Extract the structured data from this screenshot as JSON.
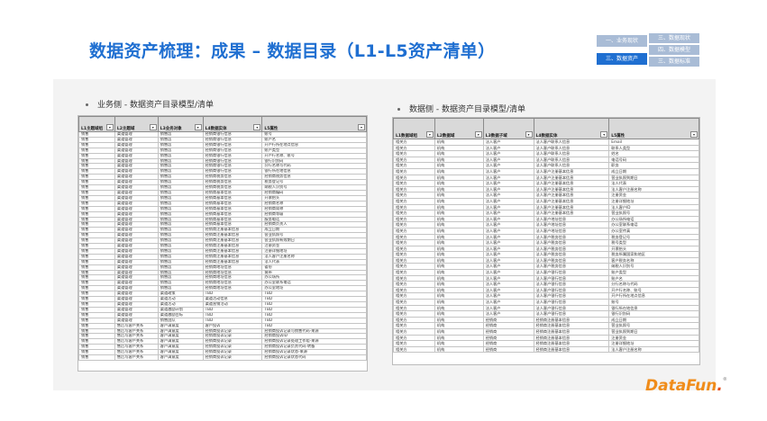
{
  "slide": {
    "title": "数据资产梳理：成果 – 数据目录（L1-L5资产清单）"
  },
  "nav": {
    "cells": [
      {
        "label": "一、业务现状",
        "bg": "#a9bcd6",
        "active": false
      },
      {
        "label": "三、数据资产",
        "bg": "#1f6fd1",
        "active": true
      },
      {
        "label": "三、数据现状",
        "bg": "#a9bcd6",
        "active": false
      },
      {
        "label": "四、数据模型",
        "bg": "#a9bcd6",
        "active": false
      },
      {
        "label": "三、数据标准",
        "bg": "#a9bcd6",
        "active": false
      }
    ]
  },
  "left": {
    "subtitle": "业务侧 - 数据资产目录模型/清单",
    "headers": [
      "L1主题域组",
      "L2主题域",
      "L3业务对象",
      "L4数据实体",
      "L5属性"
    ],
    "rows": [
      [
        "销售",
        "渠道管理",
        "销售店",
        "经销商银行信息",
        "账号"
      ],
      [
        "销售",
        "渠道管理",
        "销售店",
        "经销商银行信息",
        "账户名"
      ],
      [
        "销售",
        "渠道管理",
        "销售店",
        "经销商银行信息",
        "开户行所在地点信息"
      ],
      [
        "销售",
        "渠道管理",
        "销售店",
        "经销商银行信息",
        "账户类型"
      ],
      [
        "销售",
        "渠道管理",
        "销售店",
        "经销商银行信息",
        "开户行名称、账号"
      ],
      [
        "销售",
        "渠道管理",
        "销售店",
        "经销商银行信息",
        "银行识别码"
      ],
      [
        "销售",
        "渠道管理",
        "销售店",
        "经销商银行信息",
        "分行名称与代码"
      ],
      [
        "销售",
        "渠道管理",
        "销售店",
        "经销商银行信息",
        "银行所在地信息"
      ],
      [
        "销售",
        "渠道管理",
        "销售店",
        "经销商税务信息",
        "经销商税务信息"
      ],
      [
        "销售",
        "渠道管理",
        "销售店",
        "经销商税务信息",
        "税务登记号"
      ],
      [
        "销售",
        "渠道管理",
        "销售店",
        "经销商税务信息",
        "纳税人识别号"
      ],
      [
        "销售",
        "渠道管理",
        "销售店",
        "经销商基本信息",
        "经销商编码"
      ],
      [
        "销售",
        "渠道管理",
        "销售店",
        "经销商基本信息",
        "开票抬头"
      ],
      [
        "销售",
        "渠道管理",
        "销售店",
        "经销商基本信息",
        "经销商名称"
      ],
      [
        "销售",
        "渠道管理",
        "销售店",
        "经销商基本信息",
        "经销商简称"
      ],
      [
        "销售",
        "渠道管理",
        "销售店",
        "经销商基本信息",
        "经销商等级"
      ],
      [
        "销售",
        "渠道管理",
        "销售店",
        "经销商基本信息",
        "服务电话"
      ],
      [
        "销售",
        "渠道管理",
        "销售店",
        "经销商基本信息",
        "经销商负责人"
      ],
      [
        "销售",
        "渠道管理",
        "销售店",
        "经销商注册基本信息",
        "成立日期"
      ],
      [
        "销售",
        "渠道管理",
        "销售店",
        "经销商注册基本信息",
        "营业执照号"
      ],
      [
        "销售",
        "渠道管理",
        "销售店",
        "经销商注册基本信息",
        "营业执照有效期日"
      ],
      [
        "销售",
        "渠道管理",
        "销售店",
        "经销商注册基本信息",
        "注册资金"
      ],
      [
        "销售",
        "渠道管理",
        "销售店",
        "经销商注册基本信息",
        "注册详细地址"
      ],
      [
        "销售",
        "渠道管理",
        "销售店",
        "经销商注册基本信息",
        "法人客户注册名称"
      ],
      [
        "销售",
        "渠道管理",
        "销售店",
        "经销商注册基本信息",
        "法人代表"
      ],
      [
        "销售",
        "渠道管理",
        "销售店",
        "经销商地址信息",
        "省份"
      ],
      [
        "销售",
        "渠道管理",
        "销售店",
        "经销商地址信息",
        "城市"
      ],
      [
        "销售",
        "渠道管理",
        "销售店",
        "经销商地址信息",
        "办公场所"
      ],
      [
        "销售",
        "渠道管理",
        "销售店",
        "经销商地址信息",
        "办公室联系电话"
      ],
      [
        "销售",
        "渠道管理",
        "销售店",
        "经销商地址信息",
        "办公室地址"
      ],
      [
        "销售",
        "渠道管理",
        "渠道政策",
        "TBD",
        "TBD"
      ],
      [
        "销售",
        "渠道管理",
        "渠道活动",
        "渠道活动信息",
        "TBD"
      ],
      [
        "销售",
        "渠道管理",
        "渠道活动",
        "渠道营销活动",
        "TBD"
      ],
      [
        "销售",
        "渠道管理",
        "渠道激励计划",
        "TBD",
        "TBD"
      ],
      [
        "销售",
        "渠道管理",
        "渠道激励目标",
        "TBD",
        "TBD"
      ],
      [
        "销售",
        "渠道管理",
        "销售团队",
        "TBD",
        "TBD"
      ],
      [
        "销售",
        "售后与客户关系",
        "客户满意度",
        "客户投诉",
        "TBD"
      ],
      [
        "销售",
        "售后与客户关系",
        "客户满意度",
        "经销商投诉记录",
        "经销商投诉记录与销售代码-来源"
      ],
      [
        "销售",
        "售后与客户关系",
        "客户满意度",
        "经销商投诉记录",
        "经销商投诉ID"
      ],
      [
        "销售",
        "售后与客户关系",
        "客户满意度",
        "经销商投诉记录",
        "经销商投诉记录处理工作组-来源"
      ],
      [
        "销售",
        "售后与客户关系",
        "客户满意度",
        "经销商投诉记录",
        "经销商投诉记录负责代码-转备"
      ],
      [
        "销售",
        "售后与客户关系",
        "客户满意度",
        "经销商投诉记录",
        "经销商投诉记录状态-来源"
      ],
      [
        "销售",
        "售后与客户关系",
        "客户满意度",
        "经销商投诉记录",
        "经销商投诉记录状态代码"
      ]
    ]
  },
  "right": {
    "subtitle": "数据侧 - 数据资产目录模型/清单",
    "headers": [
      "L1数据域组",
      "L2数据域",
      "L3数据子域",
      "L4数据实体",
      "L5属性"
    ],
    "rows": [
      [
        "相关方",
        "机构",
        "法人客户",
        "法人客户联系人信息",
        "Email"
      ],
      [
        "相关方",
        "机构",
        "法人客户",
        "法人客户联系人信息",
        "联系人类型"
      ],
      [
        "相关方",
        "机构",
        "法人客户",
        "法人客户联系人信息",
        "姓名"
      ],
      [
        "相关方",
        "机构",
        "法人客户",
        "法人客户联系人信息",
        "电话号码"
      ],
      [
        "相关方",
        "机构",
        "法人客户",
        "法人客户联系人信息",
        "职务"
      ],
      [
        "相关方",
        "机构",
        "法人客户",
        "法人客户注册基本信息",
        "成立日期"
      ],
      [
        "相关方",
        "机构",
        "法人客户",
        "法人客户注册基本信息",
        "营业执照到期日"
      ],
      [
        "相关方",
        "机构",
        "法人客户",
        "法人客户注册基本信息",
        "法人代表"
      ],
      [
        "相关方",
        "机构",
        "法人客户",
        "法人客户注册基本信息",
        "法人客户注册名称"
      ],
      [
        "相关方",
        "机构",
        "法人客户",
        "法人客户注册基本信息",
        "注册资金"
      ],
      [
        "相关方",
        "机构",
        "法人客户",
        "法人客户注册基本信息",
        "注册详细地址"
      ],
      [
        "相关方",
        "机构",
        "法人客户",
        "法人客户注册基本信息",
        "法人客户ID"
      ],
      [
        "相关方",
        "机构",
        "法人客户",
        "法人客户注册基本信息",
        "营业执照号"
      ],
      [
        "相关方",
        "机构",
        "法人客户",
        "法人客户地址信息",
        "办公场所电话"
      ],
      [
        "相关方",
        "机构",
        "法人客户",
        "法人客户地址信息",
        "办公室联系电话"
      ],
      [
        "相关方",
        "机构",
        "法人客户",
        "法人客户地址信息",
        "办公室传真"
      ],
      [
        "相关方",
        "机构",
        "法人客户",
        "法人客户税务信息",
        "税务登记号"
      ],
      [
        "相关方",
        "机构",
        "法人客户",
        "法人客户税务信息",
        "税号类型"
      ],
      [
        "相关方",
        "机构",
        "法人客户",
        "法人客户税务信息",
        "开票抬头"
      ],
      [
        "相关方",
        "机构",
        "法人客户",
        "法人客户税务信息",
        "税务所属国家和地区"
      ],
      [
        "相关方",
        "机构",
        "法人客户",
        "法人客户税务信息",
        "客户税务名称"
      ],
      [
        "相关方",
        "机构",
        "法人客户",
        "法人客户税务信息",
        "纳税人识别号"
      ],
      [
        "相关方",
        "机构",
        "法人客户",
        "法人客户银行信息",
        "账户类型"
      ],
      [
        "相关方",
        "机构",
        "法人客户",
        "法人客户银行信息",
        "账户名"
      ],
      [
        "相关方",
        "机构",
        "法人客户",
        "法人客户银行信息",
        "分行名称与代码"
      ],
      [
        "相关方",
        "机构",
        "法人客户",
        "法人客户银行信息",
        "开户行名称、账号"
      ],
      [
        "相关方",
        "机构",
        "法人客户",
        "法人客户银行信息",
        "开户行所在地点信息"
      ],
      [
        "相关方",
        "机构",
        "法人客户",
        "法人客户银行信息",
        "账号"
      ],
      [
        "相关方",
        "机构",
        "法人客户",
        "法人客户银行信息",
        "银行所在地信息"
      ],
      [
        "相关方",
        "机构",
        "法人客户",
        "法人客户银行信息",
        "银行识别码"
      ],
      [
        "相关方",
        "机构",
        "经销商",
        "经销商注册基本信息",
        "成立日期"
      ],
      [
        "相关方",
        "机构",
        "经销商",
        "经销商注册基本信息",
        "营业执照号"
      ],
      [
        "相关方",
        "机构",
        "经销商",
        "经销商注册基本信息",
        "营业执照到期日"
      ],
      [
        "相关方",
        "机构",
        "经销商",
        "经销商注册基本信息",
        "注册资金"
      ],
      [
        "相关方",
        "机构",
        "经销商",
        "经销商注册基本信息",
        "注册详细地址"
      ],
      [
        "相关方",
        "机构",
        "经销商",
        "经销商注册基本信息",
        "法人客户注册名称"
      ]
    ]
  },
  "logo": {
    "data": "DataFun",
    "fun": ".",
    "reg": "®"
  }
}
